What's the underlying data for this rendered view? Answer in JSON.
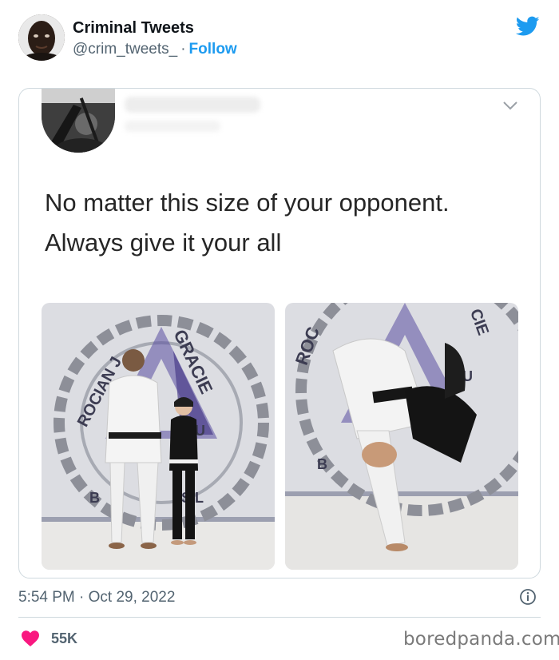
{
  "author": {
    "name": "Criminal Tweets",
    "handle": "@crim_tweets_",
    "separator": "·",
    "follow_label": "Follow"
  },
  "embedded_tweet": {
    "text_line1": "No matter this size of your opponent.",
    "text_line2": "Always give it your all"
  },
  "footer": {
    "timestamp": "5:54 PM · Oct 29, 2022",
    "like_count": "55K"
  },
  "watermark": "boredpanda.com",
  "icons": {
    "brand": "twitter-bird-icon",
    "menu": "chevron-down-icon",
    "info": "info-icon",
    "like": "heart-icon"
  },
  "colors": {
    "accent": "#1d9bf0",
    "secondary_text": "#536471",
    "like": "#f91880",
    "border": "#cfd9de"
  }
}
